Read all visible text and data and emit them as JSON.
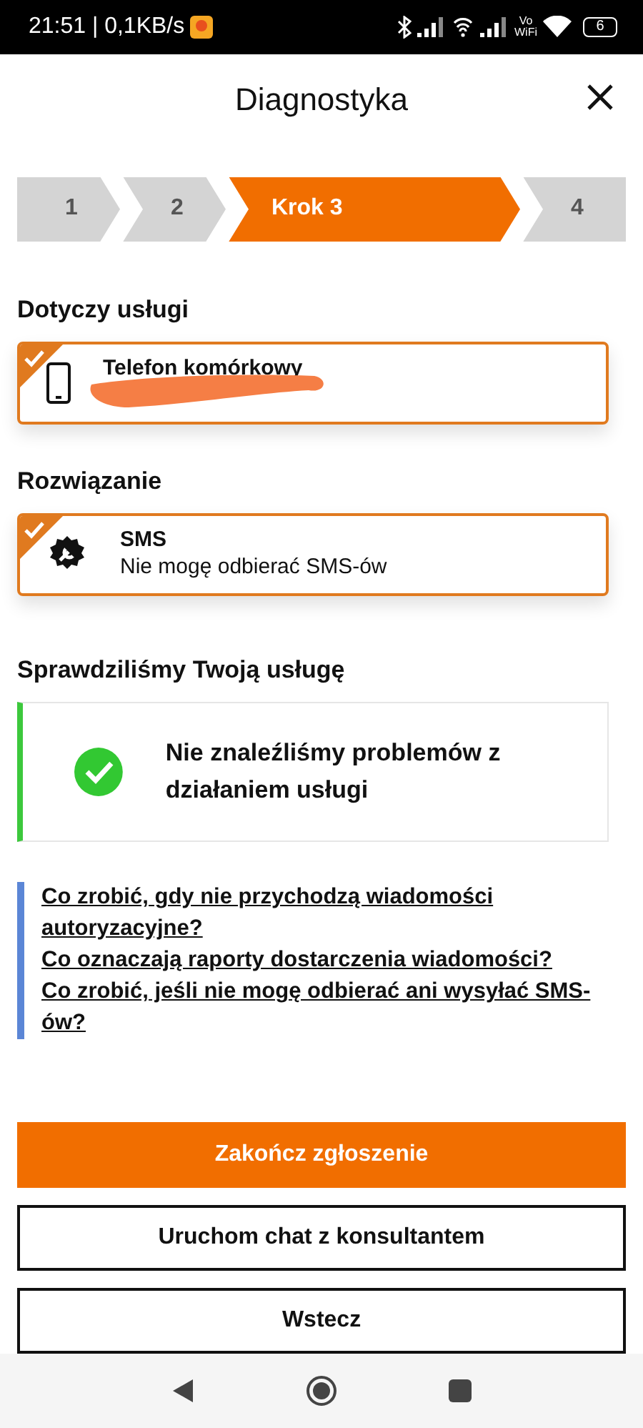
{
  "status_bar": {
    "time": "21:51 | 0,1KB/s",
    "vowifi_top": "Vo",
    "vowifi_bottom": "WiFi",
    "battery": "6"
  },
  "header": {
    "title": "Diagnostyka"
  },
  "steps": [
    {
      "label": "1",
      "selected": false
    },
    {
      "label": "2",
      "selected": false
    },
    {
      "label": "Krok 3",
      "selected": true
    },
    {
      "label": "4",
      "selected": false
    }
  ],
  "service": {
    "heading": "Dotyczy usługi",
    "card": {
      "kind": "phone",
      "title": "Telefon komórkowy",
      "checked": true,
      "redacted": true
    }
  },
  "solution": {
    "heading": "Rozwiązanie",
    "card": {
      "kind": "gear",
      "title": "SMS",
      "subtitle": "Nie mogę odbierać SMS-ów",
      "checked": true
    }
  },
  "check": {
    "heading": "Sprawdziliśmy Twoją usługę",
    "result": "Nie znaleźliśmy problemów z działaniem usługi",
    "kind": "ok"
  },
  "links": [
    "Co zrobić, gdy nie przychodzą wiadomości autoryzacyjne?",
    "Co oznaczają raporty dostarczenia wiadomości?",
    "Co zrobić, jeśli nie mogę odbierać ani wysyłać SMS-ów?"
  ],
  "buttons": [
    {
      "label": "Zakończ zgłoszenie",
      "kind": "primary"
    },
    {
      "label": "Uruchom chat z konsultantem",
      "kind": "outline"
    },
    {
      "label": "Wstecz",
      "kind": "outline"
    }
  ]
}
